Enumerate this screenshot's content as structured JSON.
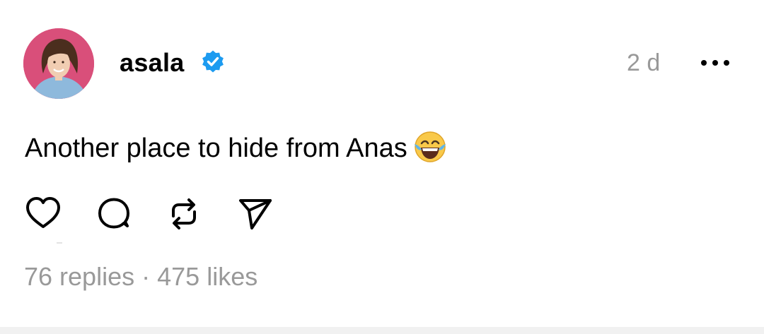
{
  "post": {
    "username": "asala",
    "time": "2 d",
    "text": "Another place to hide from Anas",
    "emoji": "😂",
    "stats": {
      "replies_text": "76 replies",
      "separator": "·",
      "likes_text": "475 likes"
    }
  },
  "colors": {
    "text": "#000000",
    "muted": "#999999",
    "verified": "#1d9bf0",
    "avatar_bg": "#d94f7a"
  },
  "icons": {
    "avatar": "profile-photo",
    "verified": "verified-badge-icon",
    "more": "more-options-icon",
    "like": "heart-icon",
    "reply": "comment-bubble-icon",
    "repost": "repost-icon",
    "share": "send-icon"
  }
}
